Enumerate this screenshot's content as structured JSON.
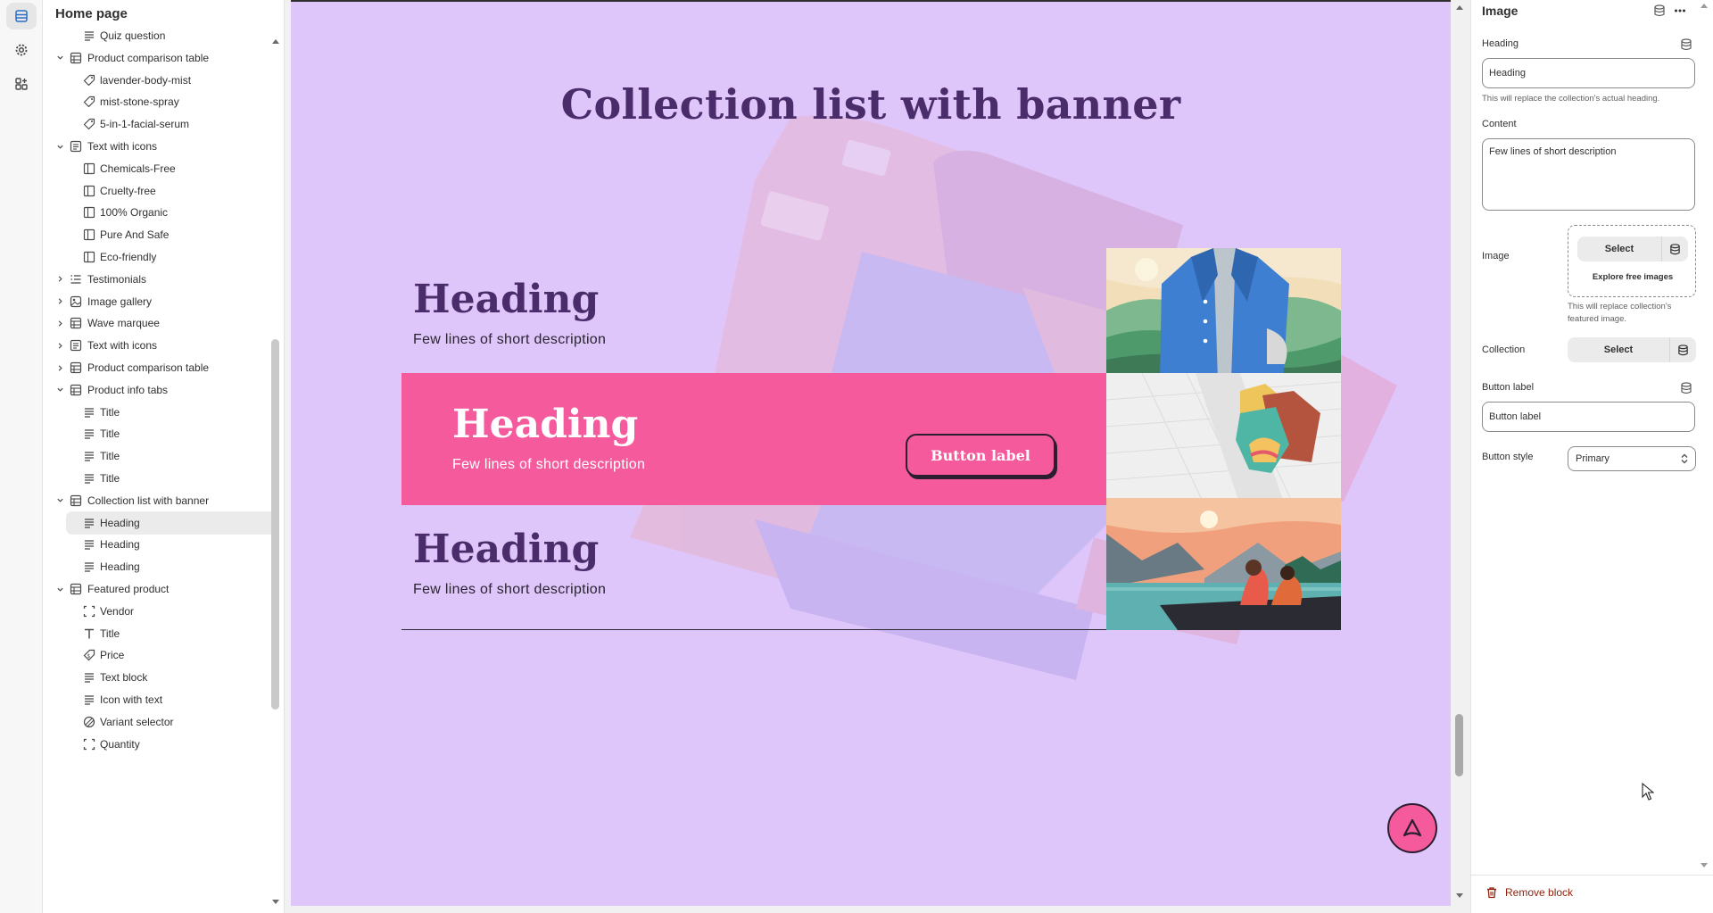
{
  "sidebar": {
    "title": "Home page",
    "items": [
      {
        "label": "Quiz question",
        "level": 2,
        "icon": "text-lines-icon"
      },
      {
        "label": "Product comparison table",
        "level": 1,
        "icon": "section-icon",
        "expanded": true
      },
      {
        "label": "lavender-body-mist",
        "level": 2,
        "icon": "tag-icon"
      },
      {
        "label": "mist-stone-spray",
        "level": 2,
        "icon": "tag-icon"
      },
      {
        "label": "5-in-1-facial-serum",
        "level": 2,
        "icon": "tag-icon"
      },
      {
        "label": "Text with icons",
        "level": 1,
        "icon": "text-section-icon",
        "expanded": true
      },
      {
        "label": "Chemicals-Free",
        "level": 2,
        "icon": "column-icon"
      },
      {
        "label": "Cruelty-free",
        "level": 2,
        "icon": "column-icon"
      },
      {
        "label": "100% Organic",
        "level": 2,
        "icon": "column-icon"
      },
      {
        "label": "Pure And Safe",
        "level": 2,
        "icon": "column-icon"
      },
      {
        "label": "Eco-friendly",
        "level": 2,
        "icon": "column-icon"
      },
      {
        "label": "Testimonials",
        "level": 1,
        "icon": "list-section-icon",
        "expanded": false
      },
      {
        "label": "Image gallery",
        "level": 1,
        "icon": "image-section-icon",
        "expanded": false
      },
      {
        "label": "Wave marquee",
        "level": 1,
        "icon": "section-icon",
        "expanded": false
      },
      {
        "label": "Text with icons",
        "level": 1,
        "icon": "text-section-icon",
        "expanded": false
      },
      {
        "label": "Product comparison table",
        "level": 1,
        "icon": "section-icon",
        "expanded": false
      },
      {
        "label": "Product info tabs",
        "level": 1,
        "icon": "section-icon",
        "expanded": true
      },
      {
        "label": "Title",
        "level": 2,
        "icon": "text-lines-icon"
      },
      {
        "label": "Title",
        "level": 2,
        "icon": "text-lines-icon"
      },
      {
        "label": "Title",
        "level": 2,
        "icon": "text-lines-icon"
      },
      {
        "label": "Title",
        "level": 2,
        "icon": "text-lines-icon"
      },
      {
        "label": "Collection list with banner",
        "level": 1,
        "icon": "section-icon",
        "expanded": true
      },
      {
        "label": "Heading",
        "level": 2,
        "icon": "text-lines-icon",
        "selected": true
      },
      {
        "label": "Heading",
        "level": 2,
        "icon": "text-lines-icon"
      },
      {
        "label": "Heading",
        "level": 2,
        "icon": "text-lines-icon"
      },
      {
        "label": "Featured product",
        "level": 1,
        "icon": "section-icon",
        "expanded": true
      },
      {
        "label": "Vendor",
        "level": 2,
        "icon": "dashed-box-icon"
      },
      {
        "label": "Title",
        "level": 2,
        "icon": "type-t-icon"
      },
      {
        "label": "Price",
        "level": 2,
        "icon": "price-tag-icon"
      },
      {
        "label": "Text block",
        "level": 2,
        "icon": "text-lines-icon"
      },
      {
        "label": "Icon with text",
        "level": 2,
        "icon": "text-lines-icon"
      },
      {
        "label": "Variant selector",
        "level": 2,
        "icon": "variant-icon"
      },
      {
        "label": "Quantity",
        "level": 2,
        "icon": "dashed-box-icon"
      }
    ]
  },
  "preview": {
    "section_title": "Collection list with banner",
    "rows": [
      {
        "heading": "Heading",
        "description": "Few lines of short description",
        "style": "plain",
        "image": "shirt-illustration"
      },
      {
        "heading": "Heading",
        "description": "Few lines of short description",
        "style": "pink",
        "button_label": "Button label",
        "image": "clothes-illustration"
      },
      {
        "heading": "Heading",
        "description": "Few lines of short description",
        "style": "plain",
        "image": "boat-illustration"
      }
    ],
    "background_color": "#dfc6fa",
    "accent_color": "#f55b9c",
    "heading_color": "#4b2c6b"
  },
  "panel": {
    "title": "Image",
    "heading_label": "Heading",
    "heading_value": "Heading",
    "heading_help": "This will replace the collection's actual heading.",
    "content_label": "Content",
    "content_value": "Few lines of short description",
    "image_label": "Image",
    "image_select": "Select",
    "image_explore": "Explore free images",
    "image_help": "This will replace collection's featured image.",
    "collection_label": "Collection",
    "collection_select": "Select",
    "button_label_label": "Button label",
    "button_label_value": "Button label",
    "button_style_label": "Button style",
    "button_style_value": "Primary",
    "remove_label": "Remove block"
  }
}
